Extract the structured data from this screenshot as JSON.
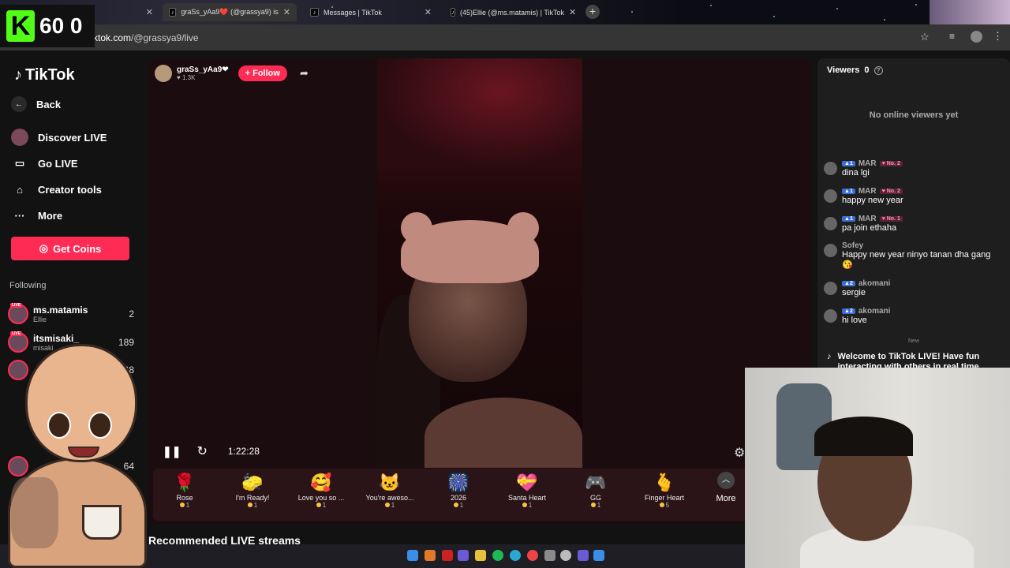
{
  "browser": {
    "tabs": [
      {
        "title": "",
        "active": false
      },
      {
        "title": "graSs_yAa9❤️ (@grassya9) is",
        "active": true
      },
      {
        "title": "Messages | TikTok",
        "active": false
      },
      {
        "title": "(45)Ellie (@ms.matamis) | TikTok",
        "active": false
      }
    ],
    "url_prefix": "tiktok.com",
    "url_path": "/@grassya9/live"
  },
  "overlay": {
    "k_logo": "K",
    "count": "60 0"
  },
  "sidebar": {
    "brand": "TikTok",
    "back": "Back",
    "items": [
      {
        "label": "Discover LIVE",
        "icon": "discover-live-icon"
      },
      {
        "label": "Go LIVE",
        "icon": "camera-icon"
      },
      {
        "label": "Creator tools",
        "icon": "home-icon"
      },
      {
        "label": "More",
        "icon": "ellipsis-icon"
      }
    ],
    "get_coins": "Get Coins",
    "following_title": "Following",
    "following": [
      {
        "name": "ms.matamis",
        "sub": "Ellie",
        "count": "2"
      },
      {
        "name": "itsmisaki_",
        "sub": "misaki",
        "count": "189"
      },
      {
        "name": "",
        "sub": "",
        "count": "68"
      },
      {
        "name": "",
        "sub": "",
        "count": "64"
      }
    ]
  },
  "live": {
    "host_name": "graSs_yAa9❤",
    "host_likes": "1.3K",
    "follow_label": "+ Follow",
    "timer": "1:22:28",
    "gifts": [
      {
        "icon": "🌹",
        "name": "Rose",
        "price": "1"
      },
      {
        "icon": "🧽",
        "name": "I'm Ready!",
        "price": "1"
      },
      {
        "icon": "🥰",
        "name": "Love you so ...",
        "price": "1"
      },
      {
        "icon": "🐱",
        "name": "You're aweso...",
        "price": "1"
      },
      {
        "icon": "🎆",
        "name": "2026",
        "price": "1"
      },
      {
        "icon": "💝",
        "name": "Santa Heart",
        "price": "1"
      },
      {
        "icon": "🎮",
        "name": "GG",
        "price": "1"
      },
      {
        "icon": "🫰",
        "name": "Finger Heart",
        "price": "5"
      }
    ],
    "more_label": "More",
    "recommended": "Recommended LIVE streams"
  },
  "chat": {
    "viewers_label": "Viewers",
    "viewers_count": "0",
    "no_viewers": "No online viewers yet",
    "messages": [
      {
        "user": "MAR",
        "level": "1",
        "rank": "No. 2",
        "text": "dina lgi"
      },
      {
        "user": "MAR",
        "level": "1",
        "rank": "No. 2",
        "text": "happy new year"
      },
      {
        "user": "MAR",
        "level": "1",
        "rank": "No. 1",
        "text": "pa join ethaha"
      },
      {
        "user": "Sofey",
        "level": "",
        "rank": "",
        "text": "Happy new year ninyo tanan dha gang 😘"
      },
      {
        "user": "akomani",
        "level": "2",
        "rank": "",
        "text": "sergie"
      },
      {
        "user": "akomani",
        "level": "2",
        "rank": "",
        "text": "hi love"
      }
    ],
    "new_divider": "New",
    "welcome": "Welcome to TikTok LIVE! Have fun interacting with others in real time"
  },
  "colors": {
    "accent": "#fe2c55",
    "kick_green": "#53fc18",
    "level_blue": "#3d6ed7"
  }
}
